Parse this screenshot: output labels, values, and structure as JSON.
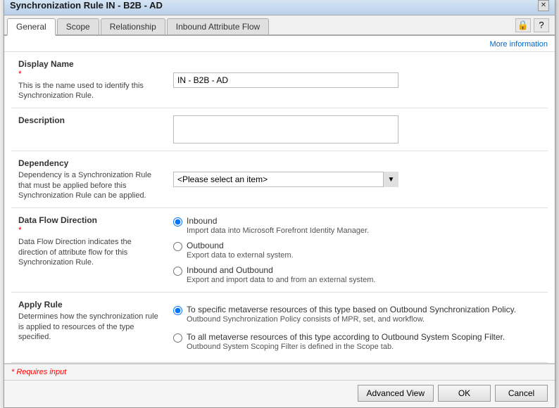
{
  "window": {
    "title": "Synchronization Rule IN - B2B - AD"
  },
  "tabs": [
    {
      "id": "general",
      "label": "General",
      "active": true
    },
    {
      "id": "scope",
      "label": "Scope",
      "active": false
    },
    {
      "id": "relationship",
      "label": "Relationship",
      "active": false
    },
    {
      "id": "inbound",
      "label": "Inbound Attribute Flow",
      "active": false
    }
  ],
  "toolbar": {
    "help_icon": "?",
    "star_icon": "★"
  },
  "more_info": {
    "label": "More information"
  },
  "form": {
    "display_name": {
      "label": "Display Name",
      "hint": "This is the name used to identify this Synchronization Rule.",
      "value": "IN - B2B - AD",
      "required": true
    },
    "description": {
      "label": "Description",
      "value": ""
    },
    "dependency": {
      "label": "Dependency",
      "hint": "Dependency is a Synchronization Rule that must be applied before this Synchronization Rule can be applied.",
      "placeholder": "<Please select an item>",
      "options": [
        "<Please select an item>"
      ]
    },
    "data_flow": {
      "label": "Data Flow Direction",
      "required": true,
      "hint": "Data Flow Direction indicates the direction of attribute flow for this Synchronization Rule.",
      "options": [
        {
          "id": "inbound",
          "label": "Inbound",
          "hint": "Import data into Microsoft Forefront Identity Manager.",
          "checked": true
        },
        {
          "id": "outbound",
          "label": "Outbound",
          "hint": "Export data to external system.",
          "checked": false
        },
        {
          "id": "inbound_outbound",
          "label": "Inbound and Outbound",
          "hint": "Export and import data to and from an external system.",
          "checked": false
        }
      ]
    },
    "apply_rule": {
      "label": "Apply Rule",
      "hint": "Determines how the synchronization rule is applied to resources of the type specified.",
      "options": [
        {
          "id": "specific",
          "label": "To specific metaverse resources of this type based on Outbound Synchronization Policy.",
          "hint": "Outbound Synchronization Policy consists of MPR, set, and workflow.",
          "checked": true
        },
        {
          "id": "all",
          "label": "To all metaverse resources of this type according to Outbound System Scoping Filter.",
          "hint": "Outbound System Scoping Filter is defined in the Scope tab.",
          "checked": false
        }
      ]
    }
  },
  "footer": {
    "requires_label": "* Requires input",
    "buttons": {
      "advanced": "Advanced View",
      "ok": "OK",
      "cancel": "Cancel"
    }
  }
}
